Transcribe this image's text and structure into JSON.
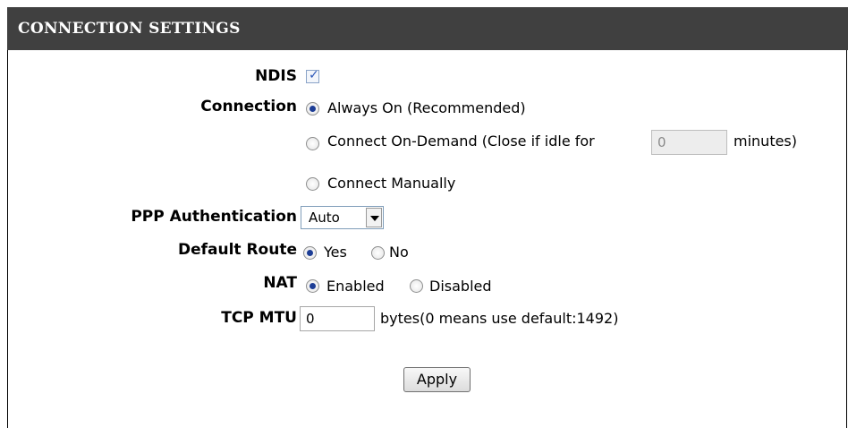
{
  "section": {
    "title": "CONNECTION SETTINGS"
  },
  "ndis": {
    "label": "NDIS",
    "checked": true
  },
  "connection": {
    "label": "Connection",
    "options": [
      {
        "label": "Always On (Recommended)",
        "checked": true
      },
      {
        "label": "Connect On-Demand (Close if idle for",
        "checked": false
      },
      {
        "label": "Connect Manually",
        "checked": false
      }
    ],
    "idle_value": "0",
    "idle_unit": "minutes)"
  },
  "ppp_auth": {
    "label": "PPP Authentication",
    "selected": "Auto"
  },
  "default_route": {
    "label": "Default Route",
    "yes": "Yes",
    "no": "No",
    "selected": "Yes"
  },
  "nat": {
    "label": "NAT",
    "enabled": "Enabled",
    "disabled": "Disabled",
    "selected": "Enabled"
  },
  "tcp_mtu": {
    "label": "TCP MTU",
    "value": "0",
    "hint": "bytes(0 means use default:1492)"
  },
  "actions": {
    "apply": "Apply"
  },
  "icons": {
    "checkmark": "checkmark-icon",
    "dropdown": "chevron-down-icon"
  }
}
